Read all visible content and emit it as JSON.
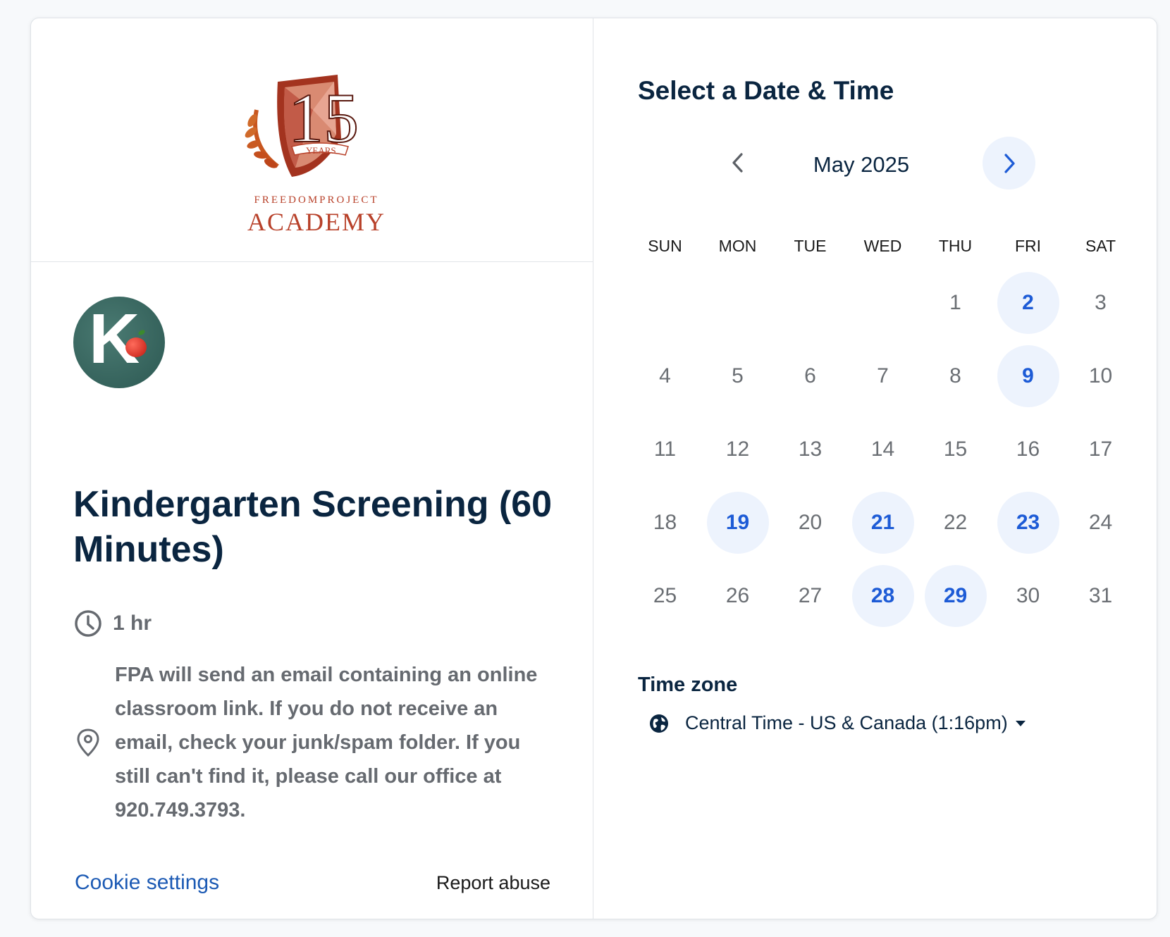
{
  "branding": {
    "logo_number": "15",
    "logo_years": "YEARS",
    "logo_line1": "FREEDOMPROJECT",
    "logo_line2": "ACADEMY",
    "avatar_letter": "K"
  },
  "event": {
    "title": "Kindergarten Screening (60 Minutes)",
    "duration": "1 hr",
    "location": "FPA will send an email containing an online classroom link. If you do not receive an email, check your junk/spam folder. If you still can't find it, please call our office at 920.749.3793."
  },
  "footer": {
    "cookie_settings": "Cookie settings",
    "report_abuse": "Report abuse"
  },
  "calendar": {
    "heading": "Select a Date & Time",
    "month_label": "May 2025",
    "weekdays": [
      "SUN",
      "MON",
      "TUE",
      "WED",
      "THU",
      "FRI",
      "SAT"
    ],
    "leading_blanks": 4,
    "days_in_month": 31,
    "available_days": [
      2,
      9,
      19,
      21,
      23,
      28,
      29
    ]
  },
  "timezone": {
    "label": "Time zone",
    "value": "Central Time - US & Canada (1:16pm)"
  },
  "colors": {
    "accent": "#1d5bd6",
    "available_bg": "#edf3fd",
    "link": "#1c5ab4",
    "heading": "#0a2540"
  }
}
